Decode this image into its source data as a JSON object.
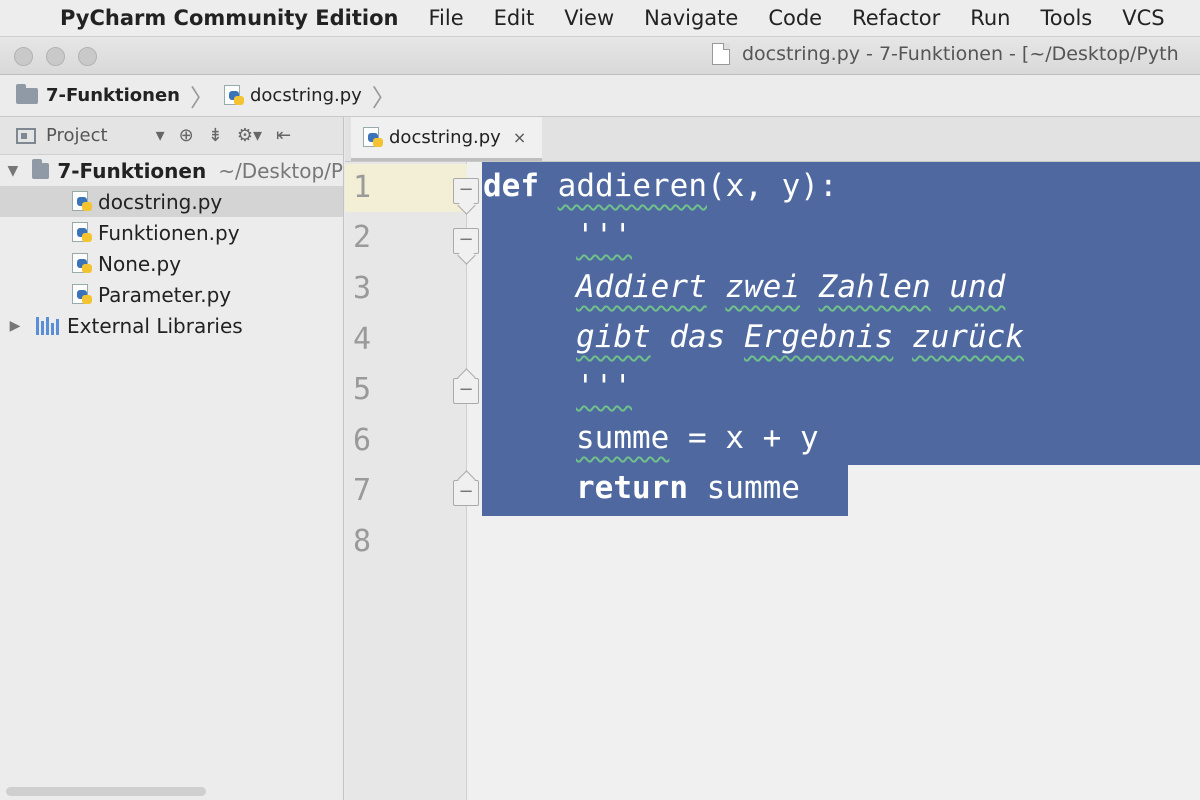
{
  "menubar": {
    "apple_glyph": "",
    "app_name": "PyCharm Community Edition",
    "items": [
      "File",
      "Edit",
      "View",
      "Navigate",
      "Code",
      "Refactor",
      "Run",
      "Tools",
      "VCS"
    ]
  },
  "window": {
    "title": "docstring.py - 7-Funktionen - [~/Desktop/Pyth"
  },
  "navbar": {
    "crumbs": [
      "7-Funktionen",
      "docstring.py"
    ]
  },
  "project_panel": {
    "title": "Project",
    "tool_icons": [
      "▾",
      "⊕",
      "⇟",
      "⚙▾",
      "⇤"
    ],
    "tree": {
      "root_label": "7-Funktionen",
      "root_path": "~/Desktop/P",
      "files": [
        "docstring.py",
        "Funktionen.py",
        "None.py",
        "Parameter.py"
      ],
      "selected_file": "docstring.py",
      "external_libraries": "External Libraries"
    }
  },
  "editor": {
    "tab_label": "docstring.py",
    "tab_close": "×",
    "line_numbers": [
      "1",
      "2",
      "3",
      "4",
      "5",
      "6",
      "7",
      "8"
    ],
    "code": {
      "l1_kw": "def",
      "l1_name": "addieren",
      "l1_rest": "(x, y):",
      "l2_quotes": "'''",
      "l3_words": [
        "Addiert",
        "zwei",
        "Zahlen",
        "und"
      ],
      "l4_words": [
        "gibt",
        "das",
        "Ergebnis",
        "zurück"
      ],
      "l5_quotes": "'''",
      "l6_var": "summe",
      "l6_rest": " = x + y",
      "l7_kw": "return",
      "l7_rest": " summe"
    }
  },
  "colors": {
    "selection": "#4f69a0",
    "caret_line": "#f3efd6",
    "squiggle": "#6fc08a"
  }
}
